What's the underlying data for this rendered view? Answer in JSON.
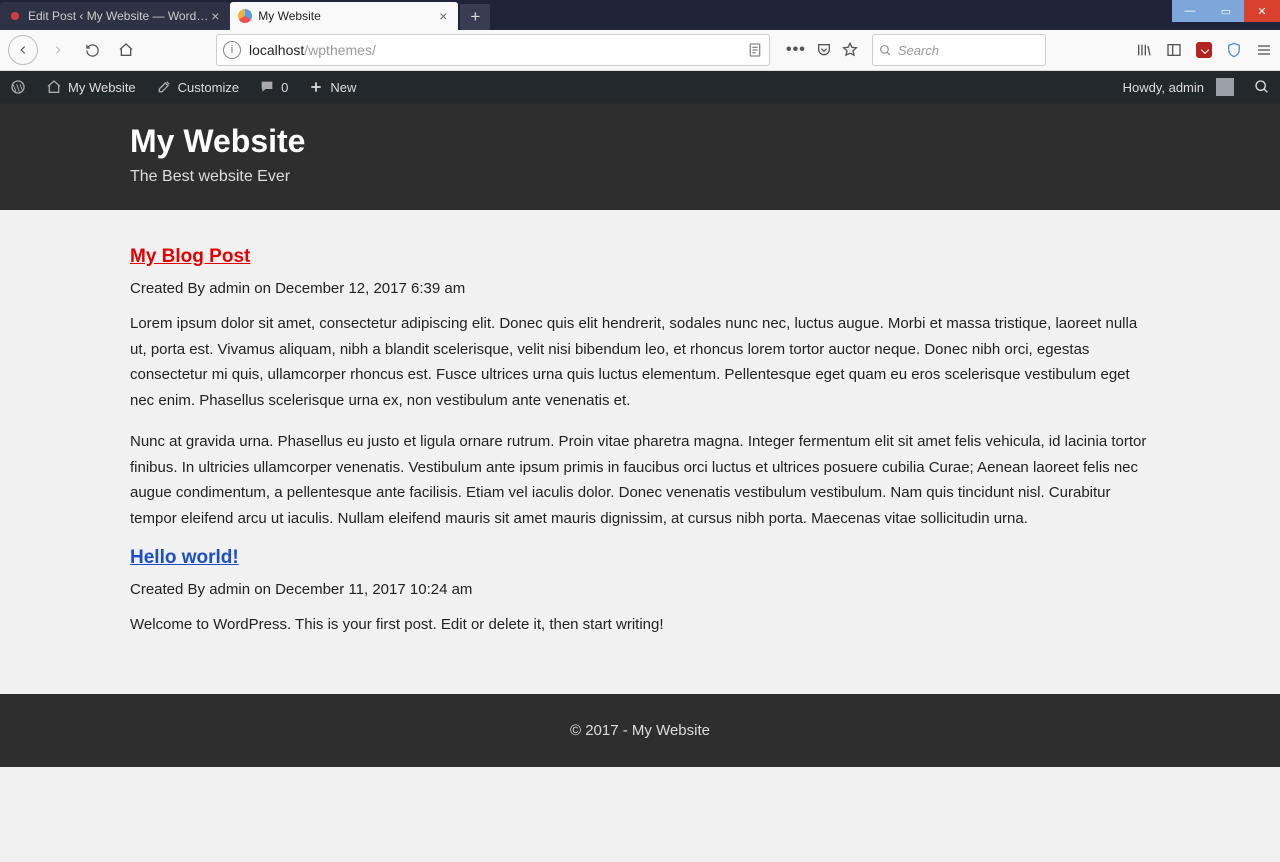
{
  "window": {
    "tabs": [
      {
        "title": "Edit Post ‹ My Website — Word…",
        "active": false
      },
      {
        "title": "My Website",
        "active": true
      }
    ]
  },
  "urlbar": {
    "host": "localhost",
    "path": "/wpthemes/"
  },
  "search_placeholder": "Search",
  "wp_adminbar": {
    "site_name": "My Website",
    "customize": "Customize",
    "comments_count": "0",
    "new_label": "New",
    "greeting": "Howdy, admin"
  },
  "site": {
    "title": "My Website",
    "tagline": "The Best website Ever"
  },
  "posts": [
    {
      "title": "My Blog Post",
      "meta": "Created By admin on December 12, 2017 6:39 am",
      "paragraphs": [
        "Lorem ipsum dolor sit amet, consectetur adipiscing elit. Donec quis elit hendrerit, sodales nunc nec, luctus augue. Morbi et massa tristique, laoreet nulla ut, porta est. Vivamus aliquam, nibh a blandit scelerisque, velit nisi bibendum leo, et rhoncus lorem tortor auctor neque. Donec nibh orci, egestas consectetur mi quis, ullamcorper rhoncus est. Fusce ultrices urna quis luctus elementum. Pellentesque eget quam eu eros scelerisque vestibulum eget nec enim. Phasellus scelerisque urna ex, non vestibulum ante venenatis et.",
        "Nunc at gravida urna. Phasellus eu justo et ligula ornare rutrum. Proin vitae pharetra magna. Integer fermentum elit sit amet felis vehicula, id lacinia tortor finibus. In ultricies ullamcorper venenatis. Vestibulum ante ipsum primis in faucibus orci luctus et ultrices posuere cubilia Curae; Aenean laoreet felis nec augue condimentum, a pellentesque ante facilisis. Etiam vel iaculis dolor. Donec venenatis vestibulum vestibulum. Nam quis tincidunt nisl. Curabitur tempor eleifend arcu ut iaculis. Nullam eleifend mauris sit amet mauris dignissim, at cursus nibh porta. Maecenas vitae sollicitudin urna."
      ],
      "title_color": "red"
    },
    {
      "title": "Hello world!",
      "meta": "Created By admin on December 11, 2017 10:24 am",
      "paragraphs": [
        "Welcome to WordPress. This is your first post. Edit or delete it, then start writing!"
      ],
      "title_color": "blue"
    }
  ],
  "footer_text": "© 2017 - My Website"
}
